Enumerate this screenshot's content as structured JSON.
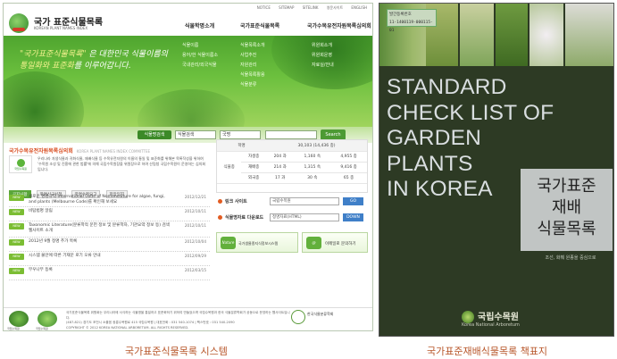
{
  "site": {
    "topnav": [
      "NOTICE",
      "SITEMAP",
      "SITELINK",
      "영문사이트",
      "ENGLISH"
    ],
    "title": "국가 표준식물목록",
    "subtitle": "KOREAN PLANT NAMES INDEX",
    "logo_caption": "국립수목원",
    "gnb": [
      "식물학명소개",
      "국가표준식물목록",
      "국가수목유전자원목록심의회"
    ],
    "hero_line1_a": "\"국가표준식물목록\"",
    "hero_line1_b": "은 대한민국 식물이름의",
    "hero_line2_a": "통일화와 표준화",
    "hero_line2_b": "를 이루어갑니다.",
    "hero_menu_1": [
      "식물이름",
      "용어/한 식물이름소",
      "국내관리/외국식물"
    ],
    "hero_menu_2": [
      "식물목록소개",
      "사업추진",
      "자원관리",
      "식물목록활용",
      "식물분류"
    ],
    "hero_menu_3": [
      "위원회소개",
      "위원회운영",
      "자료실/안내"
    ],
    "search": {
      "label": "식물명검색",
      "select1": "식물검색",
      "select2": "국명",
      "button": "Search"
    },
    "intro": {
      "title": "국가수목유전자원목록심의회",
      "title_en": "KOREA PLANT NAMES INDEX COMMITTEE",
      "logo_label": "국립수목원",
      "body": "우리나라 자생식물과 귀화식물, 재배식물 등 수목유전자원의 이름의 통일 및 표준화를 위해본 목록작성을 위하여 '수목원 조성 및 진흥에 관한 법률'에 의해 국립수목원장을 위원장으로 하여 산림청 국립수목원이 운영하는 심의회입니다."
    },
    "tabs": [
      "공지사항",
      "학명신규신청",
      "학명수정요고",
      "학망임지"
    ],
    "notices": [
      {
        "title": "새로운 명명규약 International Code of Nomenclature for algae, fungi, and plants (Melbourne Code)를 확인해 보세요",
        "date": "2012/12/21"
      },
      {
        "title": "비탐법명 알림",
        "date": "2012/10/11"
      },
      {
        "title": "Taxonomic Literature(분류학적 문헌 정보 및 분류학자, 기관요약 정보 등) 검색 웹사이트 소개",
        "date": "2012/10/11"
      },
      {
        "title": "2012년 9월 정명 추가 목록",
        "date": "2012/10/04"
      },
      {
        "title": "시스템 불안에 따른 기재문 로기 오류 안내",
        "date": "2012/09/29"
      },
      {
        "title": "무우나무 등록",
        "date": "2012/03/15"
      }
    ],
    "notice_badge": "NEW",
    "stats": {
      "header_label": "학명",
      "header_value": "30,103 (14,436 종)",
      "group": "식물종",
      "rows": [
        {
          "name": "자생종",
          "a": "204 과",
          "b": "1,160 속",
          "c": "4,955 종"
        },
        {
          "name": "재배종",
          "a": "214 과",
          "b": "1,315 속",
          "c": "9,416 종"
        },
        {
          "name": "외국종",
          "a": "17 과",
          "b": "30 속",
          "c": "65 종"
        }
      ]
    },
    "quick": [
      {
        "label": "링크 사이트",
        "select": "국립수목원",
        "button": "GO"
      },
      {
        "label": "식물명자료 다운로드",
        "select": "정명자료(HTML)",
        "button": "DOWN"
      }
    ],
    "banners": [
      {
        "icon": "Nature",
        "text": "국가생물종지식정보시스템"
      },
      {
        "icon": "@",
        "text": "이메일로 문의하기"
      }
    ],
    "footer_logos": [
      "국립수목원",
      "국립수목원"
    ],
    "footer_text": "국가표준식물목록 위원회는 우리나라에 서식하는 식물명을 통일하고 표준화하기 위하여 만들었으며 국립수목원과 한국 식물분류학회가 공동으로 운영하는 웹사이트입니다.",
    "footer_contact": "(487-821) 경기도 포천시 소흘읍 광릉수목원로 415 국립수목원 | 대표전화 : 031 540-1074 | 팩스번호 : 031 540-2090",
    "footer_copyright": "COPYRIGHT © 2012 KOREA NATIONAL ARBORETUM. ALL RIGHTS RESERVED.",
    "footer_right": "한국식물분류학회"
  },
  "cover": {
    "isbn_line1": "발간등록번호",
    "isbn_line2": "11-1400119-000115-01",
    "title_lines": [
      "STANDARD",
      "CHECK LIST OF",
      "GARDEN",
      "PLANTS",
      "IN KOREA"
    ],
    "kor_title_lines": [
      "국가표준",
      "재배",
      "식물목록"
    ],
    "kor_sub": "조선, 화훼 원종을 중심으로",
    "publisher_kor": "국립수목원",
    "publisher_eng": "Korea National Arboretum"
  },
  "captions": {
    "left": "국가표준식물목록 시스템",
    "right": "국가표준재배식물목록 책표지"
  },
  "colors": {
    "caption": "#b8572b",
    "site_green": "#5aa63a",
    "cover_bg": "#2d3a24"
  }
}
